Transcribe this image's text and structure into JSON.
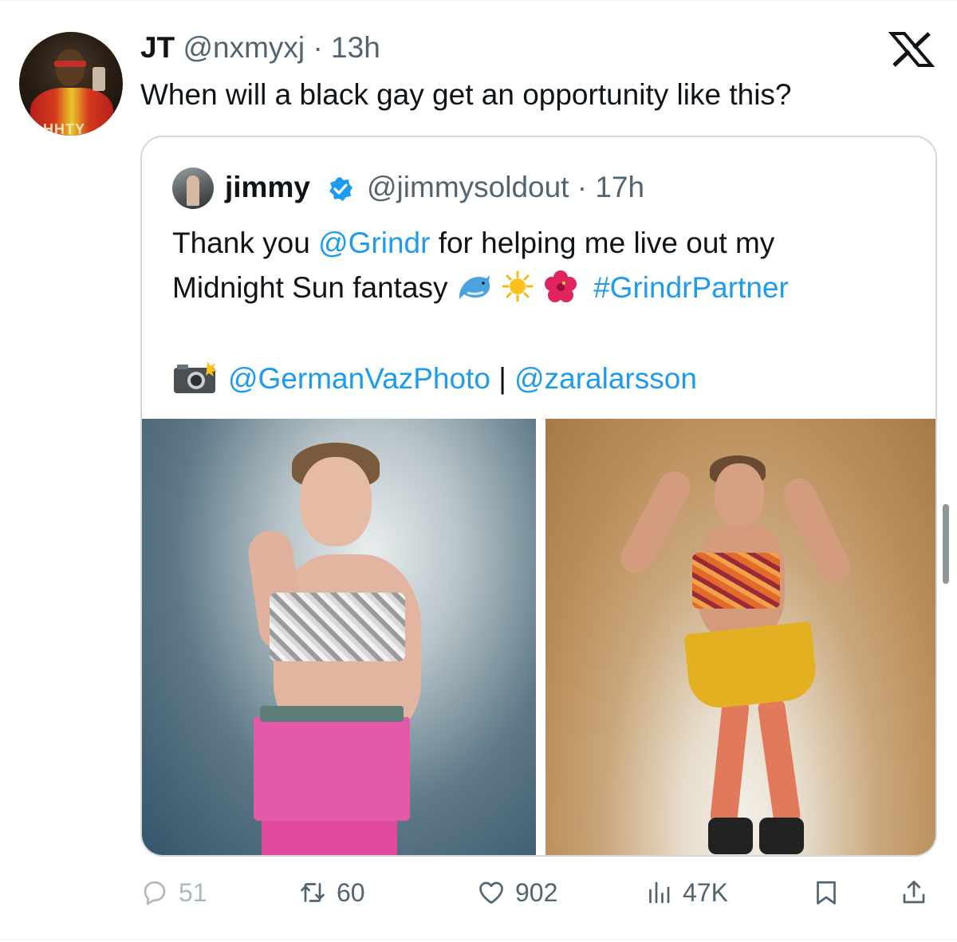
{
  "tweet": {
    "author_name": "JT",
    "author_handle": "@nxmyxj",
    "separator": "·",
    "time": "13h",
    "text": "When will a black gay get an opportunity like this?",
    "avatar_logo_text": "HHTY"
  },
  "quoted": {
    "author_name": "jimmy",
    "author_handle": "@jimmysoldout",
    "separator": "·",
    "time": "17h",
    "verified": true,
    "line1_prefix": "Thank you ",
    "line1_mention": "@Grindr",
    "line1_suffix": " for helping me live out my",
    "line2_text": "Midnight Sun fantasy",
    "line2_emojis": [
      "dolphin",
      "sun",
      "hibiscus"
    ],
    "line2_hashtag": "#GrindrPartner",
    "line3_emoji": "camera-with-flash",
    "line3_mention_1": "@GermanVazPhoto",
    "line3_separator": " | ",
    "line3_mention_2": "@zaralarsson",
    "photos": [
      "photo-pink-skirt-sequin-top",
      "photo-yellow-skirt-dancing"
    ]
  },
  "actions": {
    "replies": "51",
    "retweets": "60",
    "likes": "902",
    "views": "47K"
  },
  "icons": {
    "platform": "x-logo-icon",
    "verified": "verified-badge-icon",
    "reply": "reply-icon",
    "retweet": "retweet-icon",
    "like": "heart-icon",
    "views": "views-icon",
    "bookmark": "bookmark-icon",
    "share": "share-icon"
  },
  "colors": {
    "text": "#0f1419",
    "secondary": "#536471",
    "link": "#1d9bf0",
    "border": "#cfd9de",
    "skirt_pink": "#e25aa8",
    "skirt_yellow": "#e3b022"
  }
}
